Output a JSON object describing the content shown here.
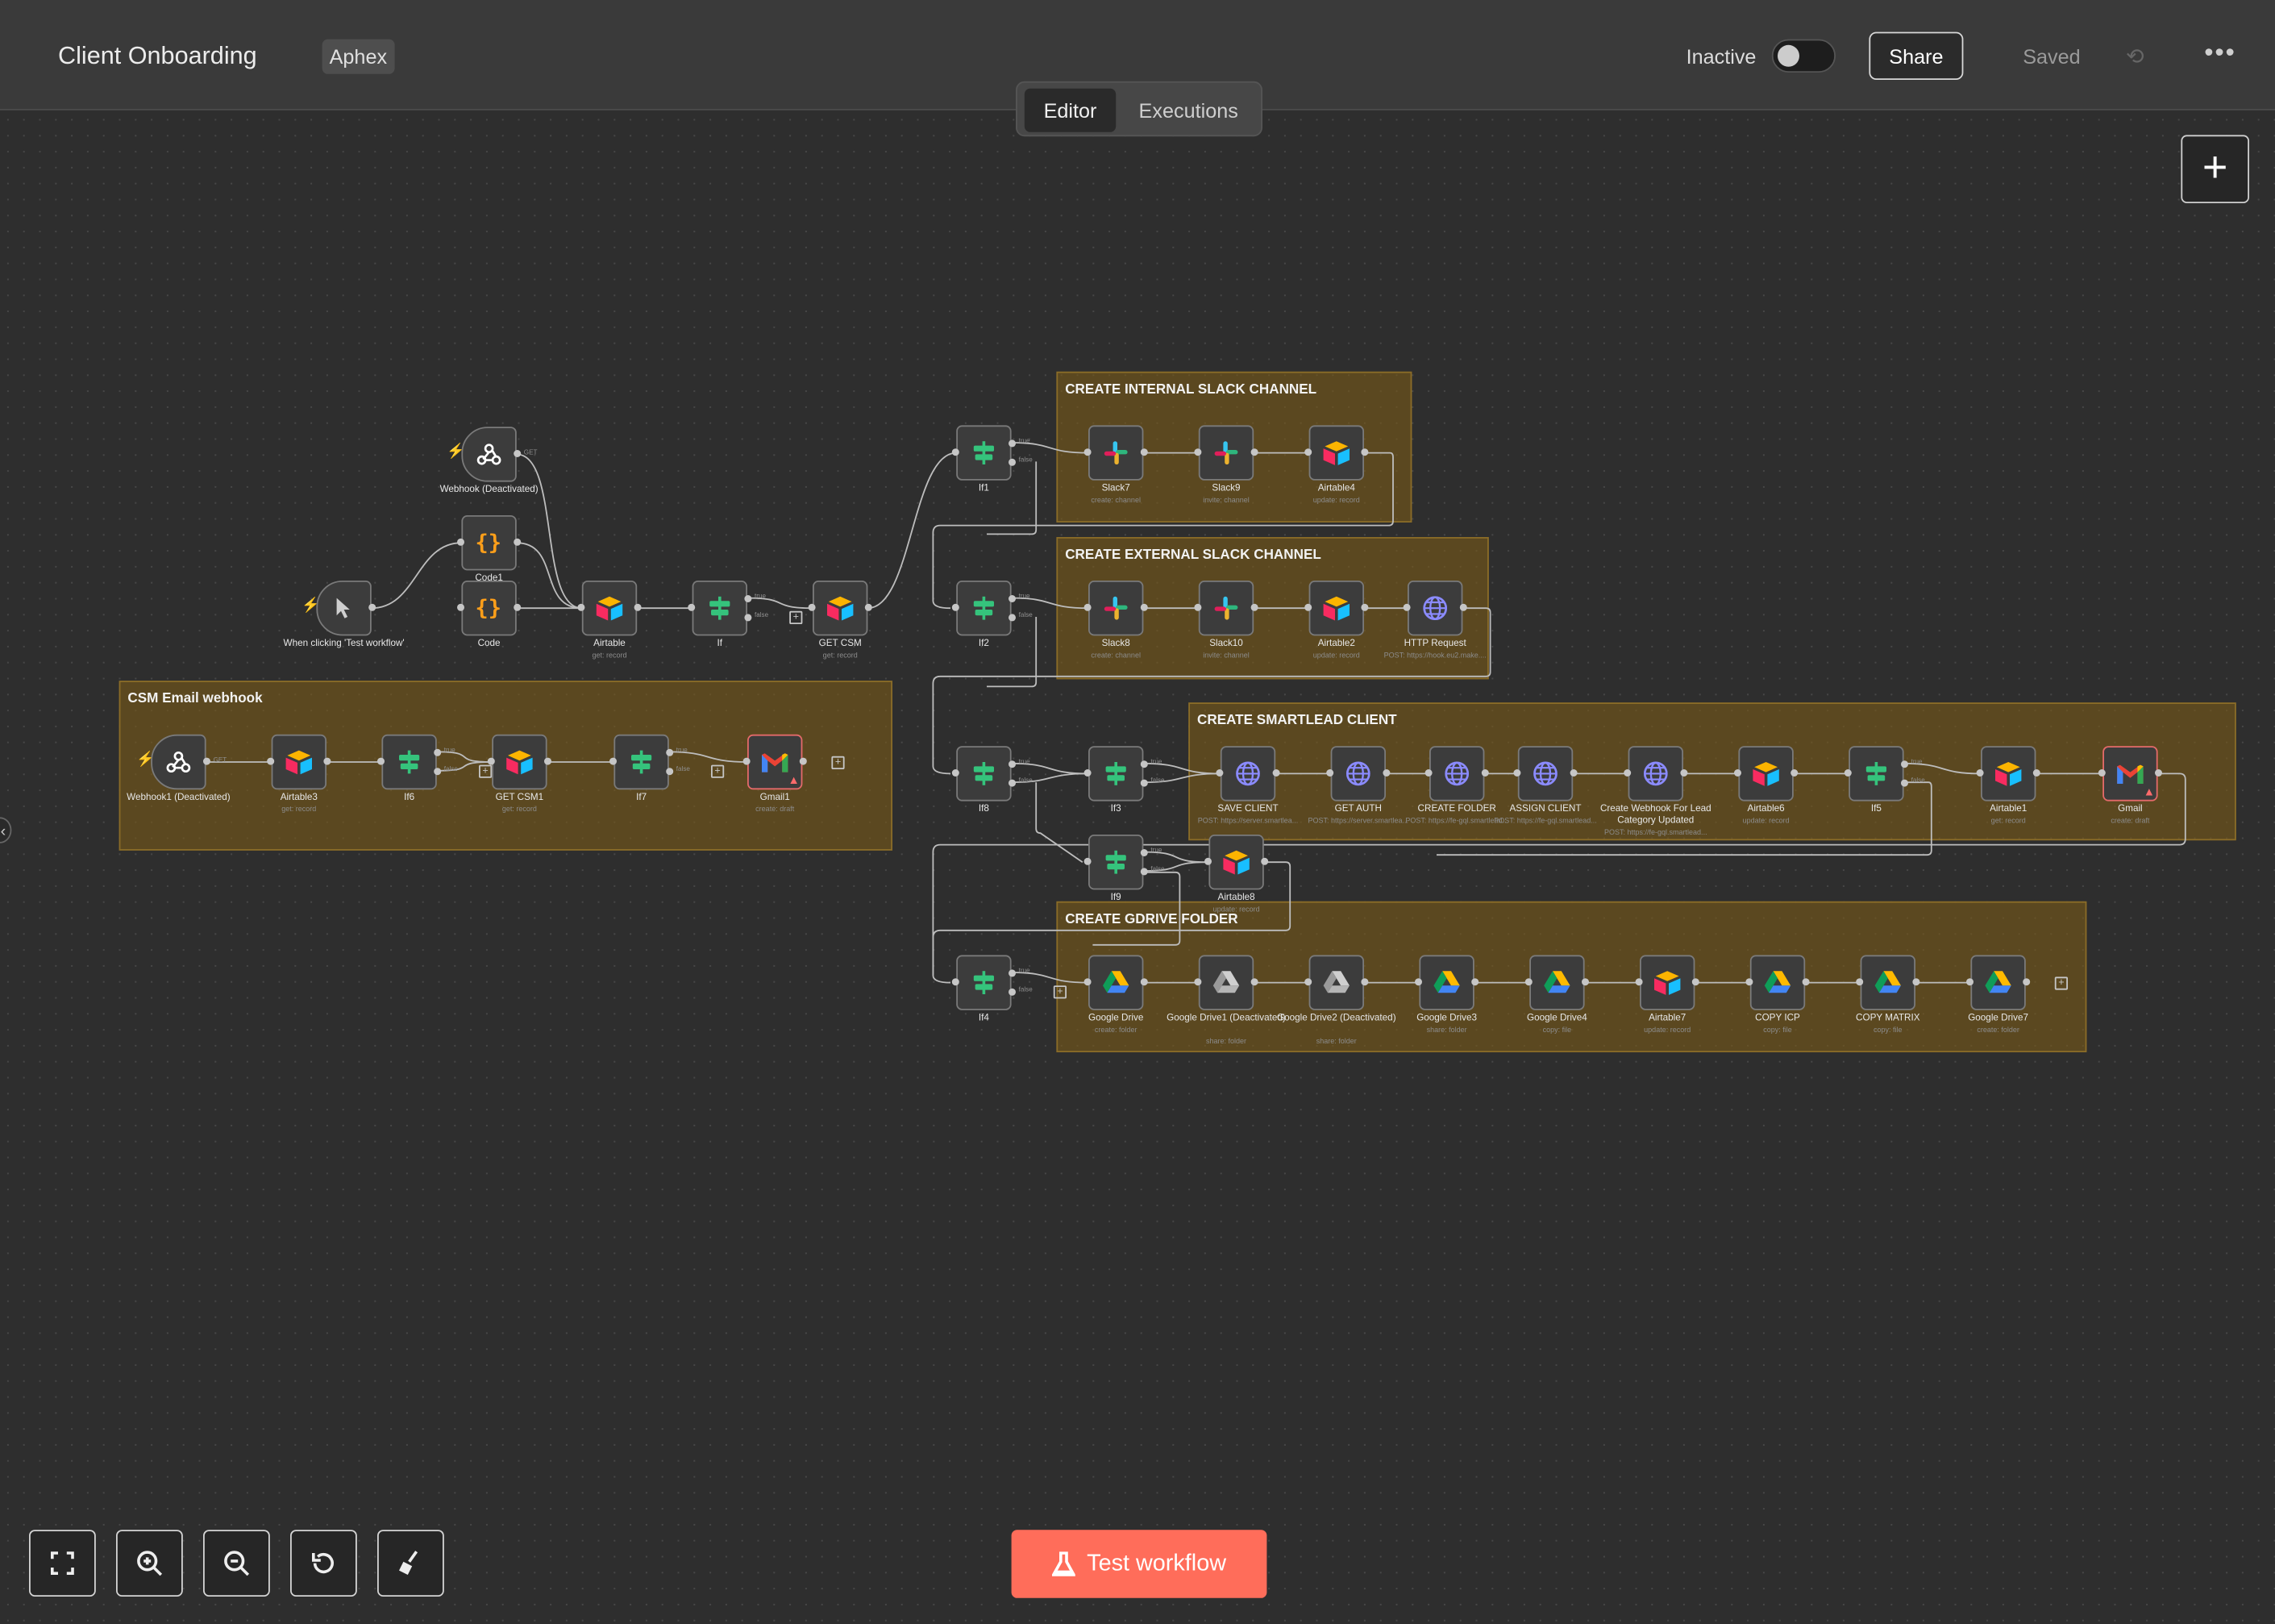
{
  "header": {
    "workflow_name": "Client Onboarding",
    "tag": "Aphex",
    "active_label": "Inactive",
    "active": false,
    "share_label": "Share",
    "save_status": "Saved"
  },
  "tabs": [
    {
      "label": "Editor",
      "active": true
    },
    {
      "label": "Executions",
      "active": false
    }
  ],
  "sticky_notes": [
    {
      "id": "s1",
      "title": "CREATE INTERNAL SLACK CHANNEL"
    },
    {
      "id": "s2",
      "title": "CREATE EXTERNAL SLACK CHANNEL"
    },
    {
      "id": "s3",
      "title": "CSM Email webhook"
    },
    {
      "id": "s4",
      "title": "CREATE SMARTLEAD CLIENT"
    },
    {
      "id": "s5",
      "title": "CREATE GDRIVE FOLDER"
    }
  ],
  "nodes": [
    {
      "id": "webhook",
      "label": "Webhook (Deactivated)",
      "sub": "",
      "icon": "webhook-icon"
    },
    {
      "id": "code1",
      "label": "Code1",
      "sub": "",
      "icon": "code-icon"
    },
    {
      "id": "trigger",
      "label": "When clicking 'Test workflow'",
      "sub": "",
      "icon": "pointer-icon"
    },
    {
      "id": "code",
      "label": "Code",
      "sub": "",
      "icon": "code-icon"
    },
    {
      "id": "airtable",
      "label": "Airtable",
      "sub": "get: record",
      "icon": "airtable-icon"
    },
    {
      "id": "if",
      "label": "If",
      "sub": "",
      "icon": "if-icon"
    },
    {
      "id": "getcsm",
      "label": "GET CSM",
      "sub": "get: record",
      "icon": "airtable-icon"
    },
    {
      "id": "if1",
      "label": "If1",
      "sub": "",
      "icon": "if-icon"
    },
    {
      "id": "slack7",
      "label": "Slack7",
      "sub": "create: channel",
      "icon": "slack-icon"
    },
    {
      "id": "slack9",
      "label": "Slack9",
      "sub": "invite: channel",
      "icon": "slack-icon"
    },
    {
      "id": "airtable4",
      "label": "Airtable4",
      "sub": "update: record",
      "icon": "airtable-icon"
    },
    {
      "id": "if2",
      "label": "If2",
      "sub": "",
      "icon": "if-icon"
    },
    {
      "id": "slack8",
      "label": "Slack8",
      "sub": "create: channel",
      "icon": "slack-icon"
    },
    {
      "id": "slack10",
      "label": "Slack10",
      "sub": "invite: channel",
      "icon": "slack-icon"
    },
    {
      "id": "airtable2",
      "label": "Airtable2",
      "sub": "update: record",
      "icon": "airtable-icon"
    },
    {
      "id": "httpreq",
      "label": "HTTP Request",
      "sub": "POST: https://hook.eu2.make....",
      "icon": "globe-icon"
    },
    {
      "id": "webhook1",
      "label": "Webhook1 (Deactivated)",
      "sub": "",
      "icon": "webhook-icon"
    },
    {
      "id": "airtable3",
      "label": "Airtable3",
      "sub": "get: record",
      "icon": "airtable-icon"
    },
    {
      "id": "if6",
      "label": "If6",
      "sub": "",
      "icon": "if-icon"
    },
    {
      "id": "getcsm1",
      "label": "GET CSM1",
      "sub": "get: record",
      "icon": "airtable-icon"
    },
    {
      "id": "if7",
      "label": "If7",
      "sub": "",
      "icon": "if-icon"
    },
    {
      "id": "gmail1",
      "label": "Gmail1",
      "sub": "create: draft",
      "icon": "gmail-icon"
    },
    {
      "id": "if8",
      "label": "If8",
      "sub": "",
      "icon": "if-icon"
    },
    {
      "id": "if3",
      "label": "If3",
      "sub": "",
      "icon": "if-icon"
    },
    {
      "id": "saveclient",
      "label": "SAVE CLIENT",
      "sub": "POST: https://server.smartlea...",
      "icon": "globe-icon"
    },
    {
      "id": "getauth",
      "label": "GET AUTH",
      "sub": "POST: https://server.smartlea...",
      "icon": "globe-icon"
    },
    {
      "id": "createfolder",
      "label": "CREATE FOLDER",
      "sub": "POST: https://fe-gql.smartlead...",
      "icon": "globe-icon"
    },
    {
      "id": "assignclient",
      "label": "ASSIGN CLIENT",
      "sub": "POST: https://fe-gql.smartlead...",
      "icon": "globe-icon"
    },
    {
      "id": "createwebhook",
      "label": "Create Webhook For Lead Category Updated",
      "sub": "POST: https://fe-gql.smartlead...",
      "icon": "globe-icon"
    },
    {
      "id": "airtable6",
      "label": "Airtable6",
      "sub": "update: record",
      "icon": "airtable-icon"
    },
    {
      "id": "if5",
      "label": "If5",
      "sub": "",
      "icon": "if-icon"
    },
    {
      "id": "airtable1",
      "label": "Airtable1",
      "sub": "get: record",
      "icon": "airtable-icon"
    },
    {
      "id": "gmail",
      "label": "Gmail",
      "sub": "create: draft",
      "icon": "gmail-icon"
    },
    {
      "id": "if9",
      "label": "If9",
      "sub": "",
      "icon": "if-icon"
    },
    {
      "id": "airtable8",
      "label": "Airtable8",
      "sub": "update: record",
      "icon": "airtable-icon"
    },
    {
      "id": "if4",
      "label": "If4",
      "sub": "",
      "icon": "if-icon"
    },
    {
      "id": "gdrive",
      "label": "Google Drive",
      "sub": "create: folder",
      "icon": "gdrive-icon"
    },
    {
      "id": "gdrive1",
      "label": "Google Drive1 (Deactivated)",
      "sub": "share: folder",
      "icon": "gdrive-icon"
    },
    {
      "id": "gdrive2",
      "label": "Google Drive2 (Deactivated)",
      "sub": "share: folder",
      "icon": "gdrive-icon"
    },
    {
      "id": "gdrive3",
      "label": "Google Drive3",
      "sub": "share: folder",
      "icon": "gdrive-icon"
    },
    {
      "id": "gdrive4",
      "label": "Google Drive4",
      "sub": "copy: file",
      "icon": "gdrive-icon"
    },
    {
      "id": "airtable7",
      "label": "Airtable7",
      "sub": "update: record",
      "icon": "airtable-icon"
    },
    {
      "id": "copyicp",
      "label": "COPY ICP",
      "sub": "copy: file",
      "icon": "gdrive-icon"
    },
    {
      "id": "copymatrix",
      "label": "COPY MATRIX",
      "sub": "copy: file",
      "icon": "gdrive-icon"
    },
    {
      "id": "gdrive7",
      "label": "Google Drive7",
      "sub": "create: folder",
      "icon": "gdrive-icon"
    }
  ],
  "branch_labels": {
    "true": "true",
    "false": "false",
    "webhook_method": "GET"
  },
  "controls": [
    {
      "name": "zoom-to-fit-button",
      "icon": "fit-view-icon"
    },
    {
      "name": "zoom-in-button",
      "icon": "zoom-in-icon"
    },
    {
      "name": "zoom-out-button",
      "icon": "zoom-out-icon"
    },
    {
      "name": "reset-zoom-button",
      "icon": "reset-icon"
    },
    {
      "name": "tidy-up-button",
      "icon": "broom-icon"
    }
  ],
  "test_button": {
    "label": "Test workflow",
    "icon": "flask-icon"
  },
  "colors": {
    "canvas": "#2e2e2e",
    "sticky": "#785819",
    "accent": "#ff6d5a",
    "node_border": "#7a7a7a",
    "error_border": "#e46a6a",
    "trigger_bolt": "#ff7a3a"
  }
}
